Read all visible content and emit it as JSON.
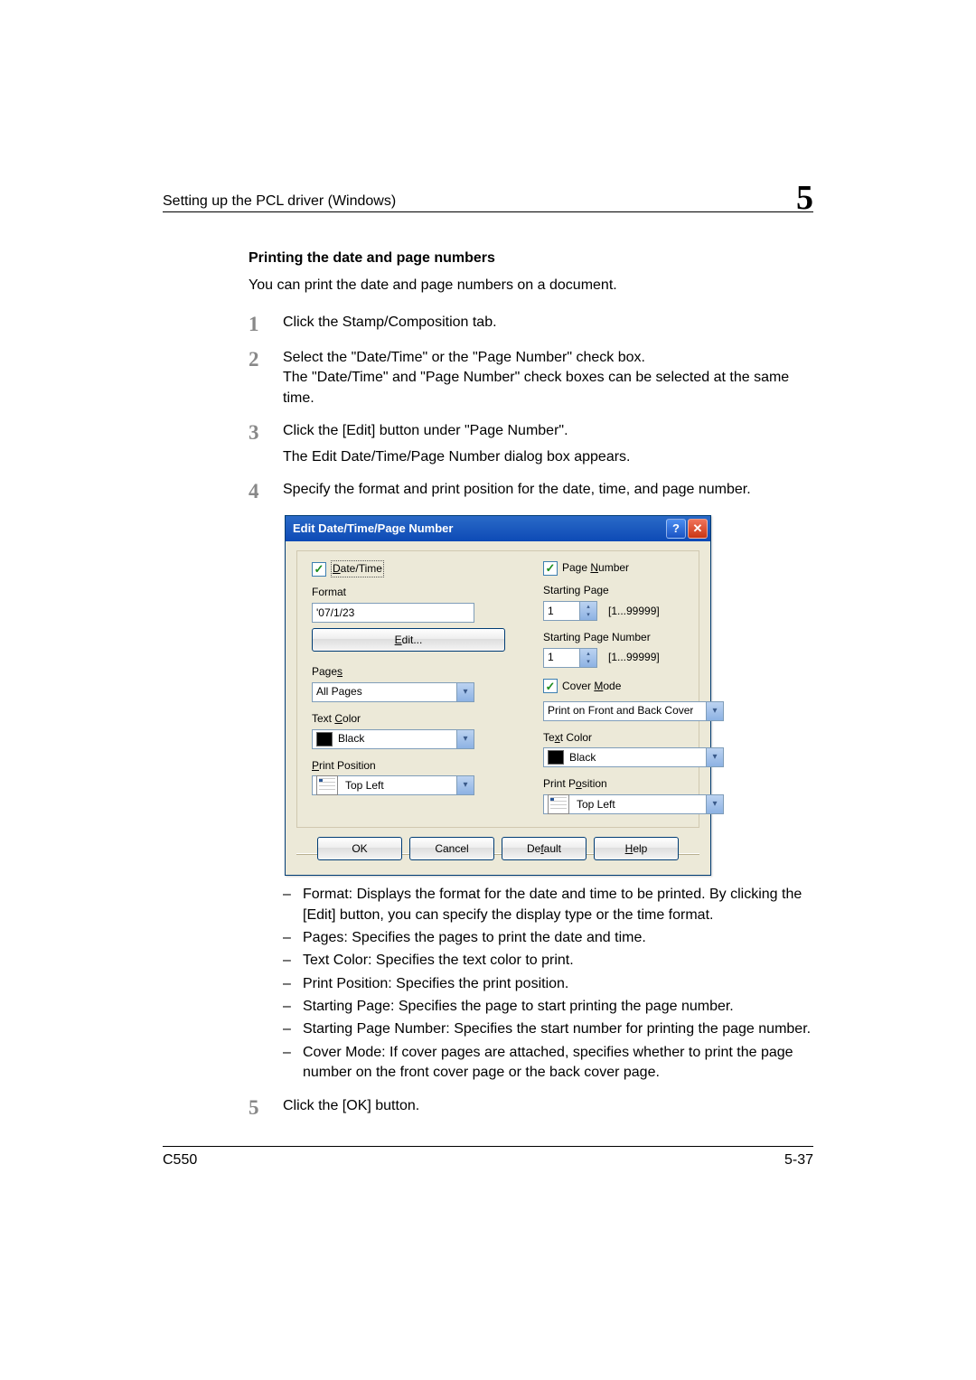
{
  "header": {
    "section_title": "Setting up the PCL driver (Windows)",
    "chapter_number": "5"
  },
  "section": {
    "title": "Printing the date and page numbers",
    "intro": "You can print the date and page numbers on a document."
  },
  "steps": {
    "s1": {
      "num": "1",
      "text": "Click the Stamp/Composition tab."
    },
    "s2": {
      "num": "2",
      "text": "Select the \"Date/Time\" or the \"Page Number\" check box.",
      "sub": "The \"Date/Time\" and \"Page Number\" check boxes can be selected at the same time."
    },
    "s3": {
      "num": "3",
      "text": "Click the [Edit] button under \"Page Number\".",
      "sub": "The Edit Date/Time/Page Number dialog box appears."
    },
    "s4": {
      "num": "4",
      "text": "Specify the format and print position for the date, time, and page number."
    },
    "s5": {
      "num": "5",
      "text": "Click the [OK] button."
    }
  },
  "dialog": {
    "title": "Edit Date/Time/Page Number",
    "left": {
      "chk_datetime": "Date/Time",
      "format_label": "Format",
      "format_value": "'07/1/23",
      "edit_btn": "Edit...",
      "pages_label": "Pages",
      "pages_value": "All Pages",
      "textcolor_label": "Text Color",
      "textcolor_value": "Black",
      "printpos_label": "Print Position",
      "printpos_value": "Top Left"
    },
    "right": {
      "chk_pagenum": "Page Number",
      "startpage_label": "Starting Page",
      "startpage_value": "1",
      "startpage_range": "[1...99999]",
      "startnum_label": "Starting Page Number",
      "startnum_value": "1",
      "startnum_range": "[1...99999]",
      "chk_cover": "Cover Mode",
      "cover_value": "Print on Front and Back Cover",
      "textcolor_label": "Text Color",
      "textcolor_value": "Black",
      "printpos_label": "Print Position",
      "printpos_value": "Top Left"
    },
    "buttons": {
      "ok": "OK",
      "cancel": "Cancel",
      "default": "Default",
      "help": "Help"
    }
  },
  "bullets": {
    "b1": "Format: Displays the format for the date and time to be printed. By clicking the [Edit] button, you can specify the display type or the time format.",
    "b2": "Pages: Specifies the pages to print the date and time.",
    "b3": "Text Color: Specifies the text color to print.",
    "b4": "Print Position: Specifies the print position.",
    "b5": "Starting Page: Specifies the page to start printing the page number.",
    "b6": "Starting Page Number: Specifies the start number for printing the page number.",
    "b7": "Cover Mode: If cover pages are attached, specifies whether to print the page number on the front cover page or the back cover page."
  },
  "footer": {
    "model": "C550",
    "page": "5-37"
  }
}
